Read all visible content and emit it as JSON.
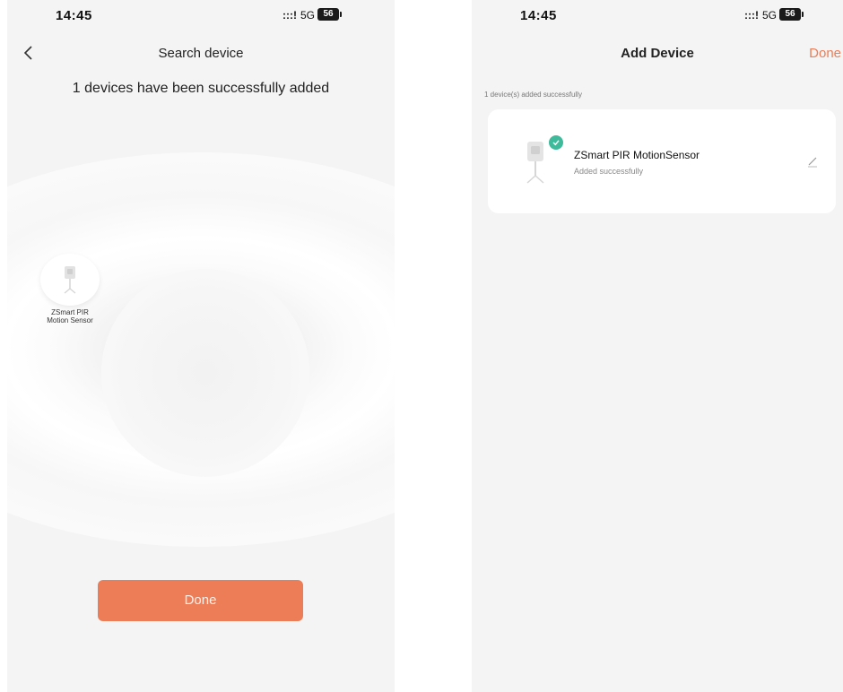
{
  "left_screen": {
    "status_bar": {
      "time": "14:45",
      "signal": ":::!",
      "network": "5G",
      "battery": "56"
    },
    "title": "Search device",
    "message": "1 devices have been successfully added",
    "found_device": {
      "label_line1": "ZSmart PIR",
      "label_line2": "Motion Sensor"
    },
    "done_button": "Done"
  },
  "right_screen": {
    "status_bar": {
      "time": "14:45",
      "signal": ":::!",
      "network": "5G",
      "battery": "56"
    },
    "title": "Add Device",
    "done_link": "Done",
    "caption": "1 device(s) added successfully",
    "device": {
      "name": "ZSmart PIR MotionSensor",
      "status": "Added successfully"
    }
  },
  "colors": {
    "accent": "#ec7d57",
    "success": "#3fba9b"
  },
  "icons": [
    "back-arrow-icon",
    "pir-sensor-icon",
    "check-icon",
    "edit-pencil-icon"
  ]
}
